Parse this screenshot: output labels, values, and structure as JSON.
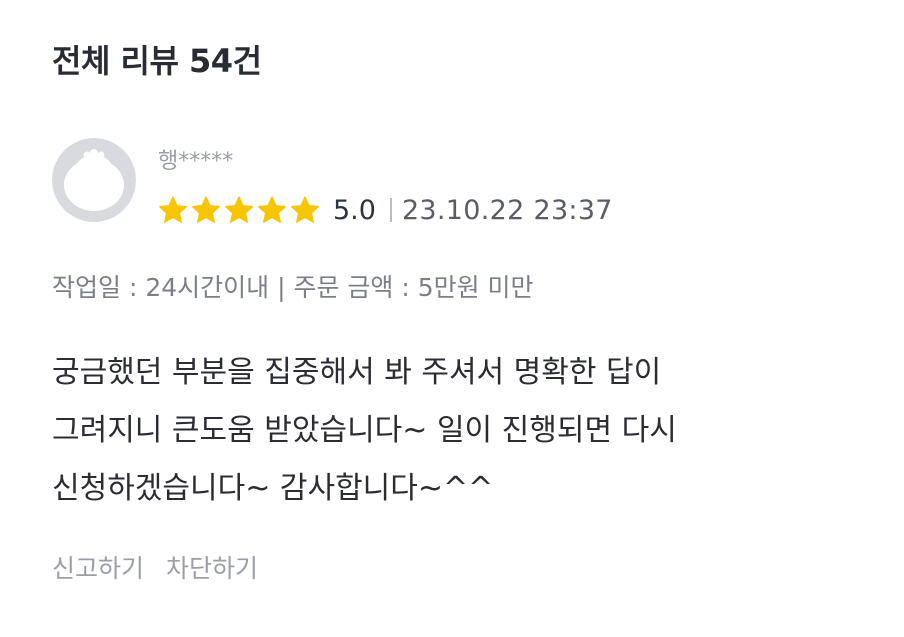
{
  "header": {
    "title": "전체 리뷰 54건"
  },
  "review": {
    "avatar_icon": "default-user-avatar-icon",
    "reviewer_name": "행*****",
    "star_icon": "star-icon",
    "star_color": "#F7C600",
    "rating_stars": 5,
    "rating_value": "5.0",
    "date": "23.10.22 23:37",
    "meta": "작업일 : 24시간이내 | 주문 금액 : 5만원 미만",
    "body_lines": [
      "궁금했던 부분을 집중해서 봐 주셔서 명확한 답이",
      "그려지니 큰도움 받았습니다~ 일이 진행되면 다시",
      "신청하겠습니다~ 감사합니다~^^"
    ]
  },
  "actions": {
    "report_label": "신고하기",
    "block_label": "차단하기"
  }
}
